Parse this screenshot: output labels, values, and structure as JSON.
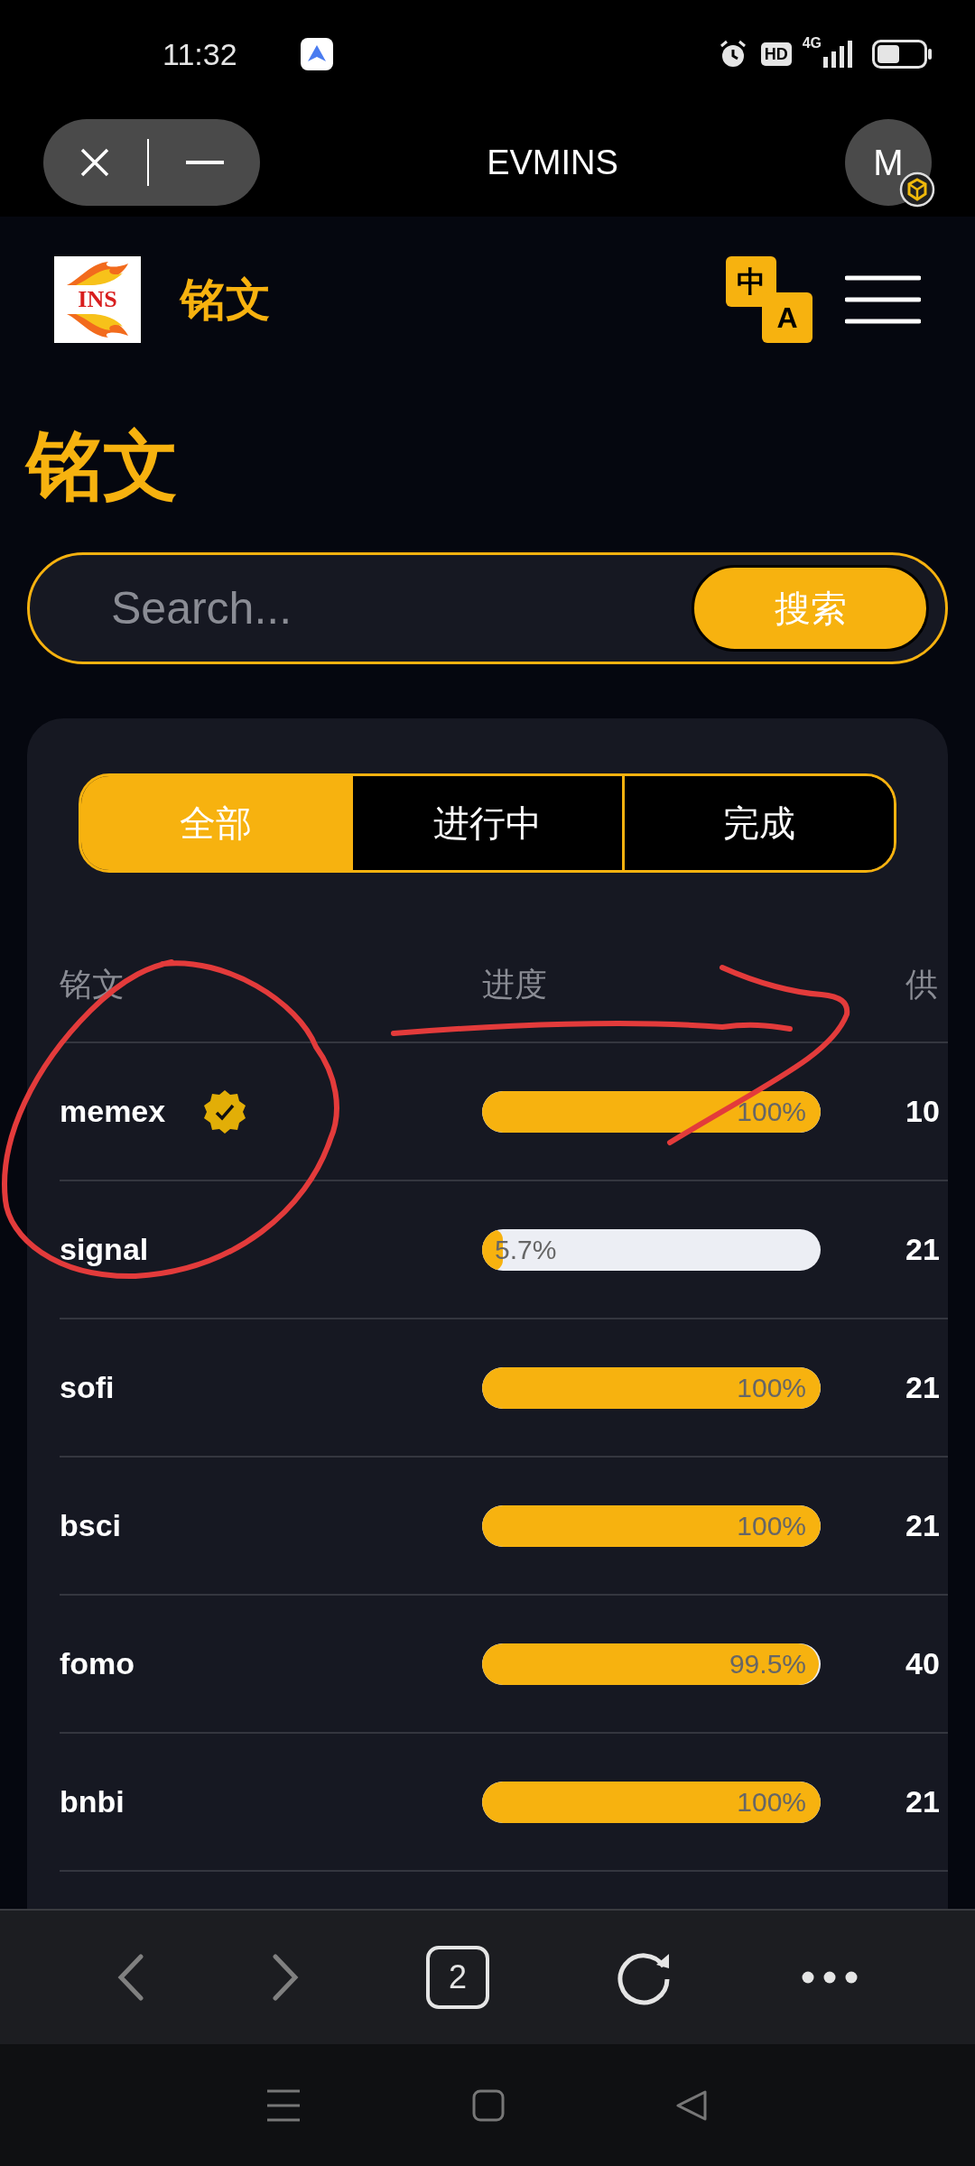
{
  "status_bar": {
    "time": "11:32",
    "hd": "HD",
    "network": "4G"
  },
  "browser": {
    "title": "EVMINS",
    "avatar_letter": "M",
    "tab_count": "2"
  },
  "header": {
    "logo_text": "INS",
    "title": "铭文",
    "translate_from": "中",
    "translate_to": "A"
  },
  "page_title": "铭文",
  "search": {
    "placeholder": "Search...",
    "button": "搜索"
  },
  "tabs": [
    {
      "label": "全部",
      "selected": true
    },
    {
      "label": "进行中",
      "selected": false
    },
    {
      "label": "完成",
      "selected": false
    }
  ],
  "table": {
    "columns": [
      "铭文",
      "进度",
      "供"
    ],
    "rows": [
      {
        "name": "memex",
        "verified": true,
        "level": 1,
        "progress": "100%",
        "supply": "10"
      },
      {
        "name": "signal",
        "verified": false,
        "level": 0.057,
        "progress": "5.7%",
        "supply": "21"
      },
      {
        "name": "sofi",
        "verified": false,
        "level": 1,
        "progress": "100%",
        "supply": "21"
      },
      {
        "name": "bsci",
        "verified": false,
        "level": 1,
        "progress": "100%",
        "supply": "21"
      },
      {
        "name": "fomo",
        "verified": false,
        "level": 0.995,
        "progress": "99.5%",
        "supply": "40"
      },
      {
        "name": "bnbi",
        "verified": false,
        "level": 1,
        "progress": "100%",
        "supply": "21"
      }
    ]
  }
}
